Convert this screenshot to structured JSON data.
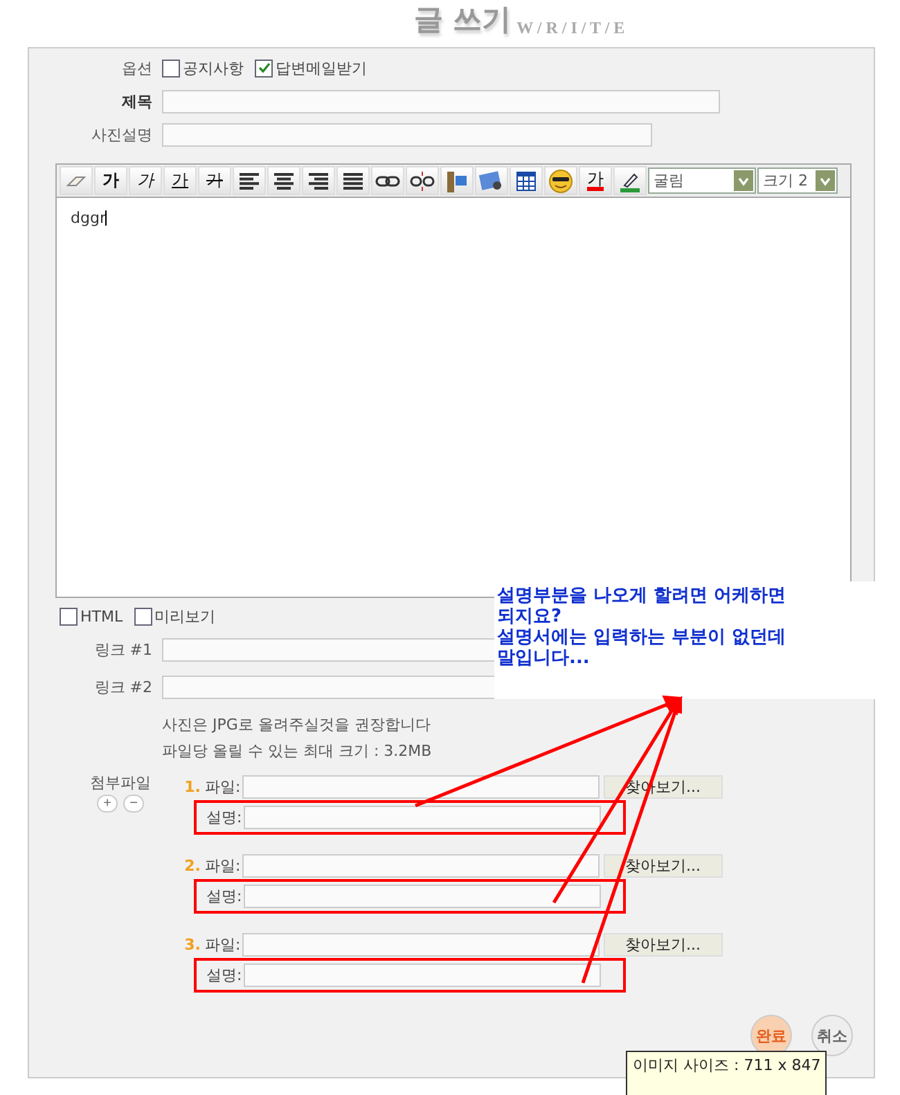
{
  "title": {
    "main": "글 쓰기",
    "sub": "W / R / I / T / E"
  },
  "options": {
    "label": "옵션",
    "items": [
      {
        "label": "공지사항",
        "checked": false
      },
      {
        "label": "답변메일받기",
        "checked": true
      }
    ]
  },
  "subject": {
    "label": "제목"
  },
  "photo_caption": {
    "label": "사진설명"
  },
  "toolbar": [
    {
      "kind": "eraser"
    },
    {
      "kind": "bold",
      "label": "가"
    },
    {
      "kind": "italic",
      "label": "가"
    },
    {
      "kind": "underline",
      "label": "가"
    },
    {
      "kind": "strike",
      "label": "가"
    },
    {
      "kind": "align-left"
    },
    {
      "kind": "align-center"
    },
    {
      "kind": "align-right"
    },
    {
      "kind": "justify"
    },
    {
      "kind": "link"
    },
    {
      "kind": "unlink"
    },
    {
      "kind": "media"
    },
    {
      "kind": "image"
    },
    {
      "kind": "table"
    },
    {
      "kind": "emoticon"
    },
    {
      "kind": "color",
      "label": "가"
    },
    {
      "kind": "highlight"
    }
  ],
  "font_select": {
    "value": "굴림"
  },
  "size_select": {
    "value": "크기 2"
  },
  "editor": {
    "value": "dggr"
  },
  "editor_options": [
    {
      "label": "HTML",
      "checked": false
    },
    {
      "label": "미리보기",
      "checked": false
    }
  ],
  "links": [
    {
      "label": "링크 #1"
    },
    {
      "label": "링크 #2"
    }
  ],
  "notes": [
    "사진은 JPG로 올려주실것을 권장합니다",
    "파일당 올릴 수 있는 최대 크기 : 3.2MB"
  ],
  "attachments": {
    "label": "첨부파일",
    "add": "+",
    "remove": "−",
    "items": [
      {
        "number": "1.",
        "file_label": "파일:",
        "browse": "찾아보기...",
        "caption_label": "설명:",
        "highlighted": true
      },
      {
        "number": "2.",
        "file_label": "파일:",
        "browse": "찾아보기...",
        "caption_label": "설명:",
        "highlighted": true
      },
      {
        "number": "3.",
        "file_label": "파일:",
        "browse": "찾아보기...",
        "caption_label": "설명:",
        "highlighted": true
      }
    ]
  },
  "buttons": [
    {
      "label": "완료"
    },
    {
      "label": "취소"
    }
  ],
  "annotation": {
    "lines": [
      "설명부분을 나오게 할려면 어케하면",
      "되지요?",
      "설명서에는 입력하는 부분이 없던데",
      "말입니다..."
    ]
  },
  "tooltip": {
    "text": "이미지 사이즈 : 711 x 847"
  }
}
